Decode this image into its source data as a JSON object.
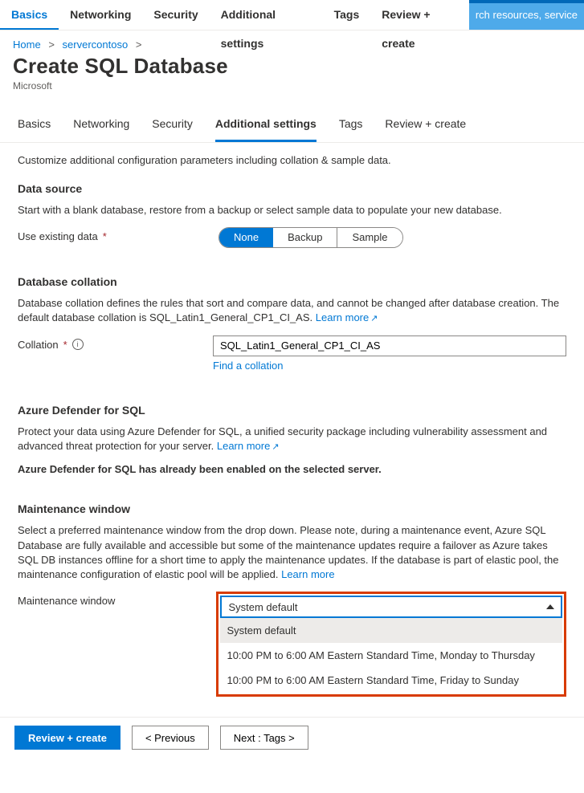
{
  "searchPlaceholder": "rch resources, service",
  "topTabs": [
    "Basics",
    "Networking",
    "Security",
    "Additional settings",
    "Tags",
    "Review + create"
  ],
  "topActive": 0,
  "breadcrumb": {
    "home": "Home",
    "server": "servercontoso"
  },
  "title": "Create SQL Database",
  "subtitle": "Microsoft",
  "innerTabs": [
    "Basics",
    "Networking",
    "Security",
    "Additional settings",
    "Tags",
    "Review + create"
  ],
  "innerActive": 3,
  "intro": "Customize additional configuration parameters including collation & sample data.",
  "dataSource": {
    "heading": "Data source",
    "desc": "Start with a blank database, restore from a backup or select sample data to populate your new database.",
    "label": "Use existing data",
    "options": [
      "None",
      "Backup",
      "Sample"
    ],
    "selected": 0
  },
  "collation": {
    "heading": "Database collation",
    "desc": "Database collation defines the rules that sort and compare data, and cannot be changed after database creation. The default database collation is SQL_Latin1_General_CP1_CI_AS. ",
    "learn": "Learn more",
    "label": "Collation",
    "value": "SQL_Latin1_General_CP1_CI_AS",
    "findLink": "Find a collation"
  },
  "defender": {
    "heading": "Azure Defender for SQL",
    "desc": "Protect your data using Azure Defender for SQL, a unified security package including vulnerability assessment and advanced threat protection for your server. ",
    "learn": "Learn more",
    "status": "Azure Defender for SQL has already been enabled on the selected server."
  },
  "maintenance": {
    "heading": "Maintenance window",
    "desc": "Select a preferred maintenance window from the drop down. Please note, during a maintenance event, Azure SQL Database are fully available and accessible but some of the maintenance updates require a failover as Azure takes SQL DB instances offline for a short time to apply the maintenance updates. If the database is part of elastic pool, the maintenance configuration of elastic pool will be applied. ",
    "learn": "Learn more",
    "label": "Maintenance window",
    "selected": "System default",
    "options": [
      "System default",
      "10:00 PM to 6:00 AM Eastern Standard Time, Monday to Thursday",
      "10:00 PM to 6:00 AM Eastern Standard Time, Friday to Sunday"
    ]
  },
  "footer": {
    "review": "Review + create",
    "prev": "< Previous",
    "next": "Next : Tags >"
  }
}
